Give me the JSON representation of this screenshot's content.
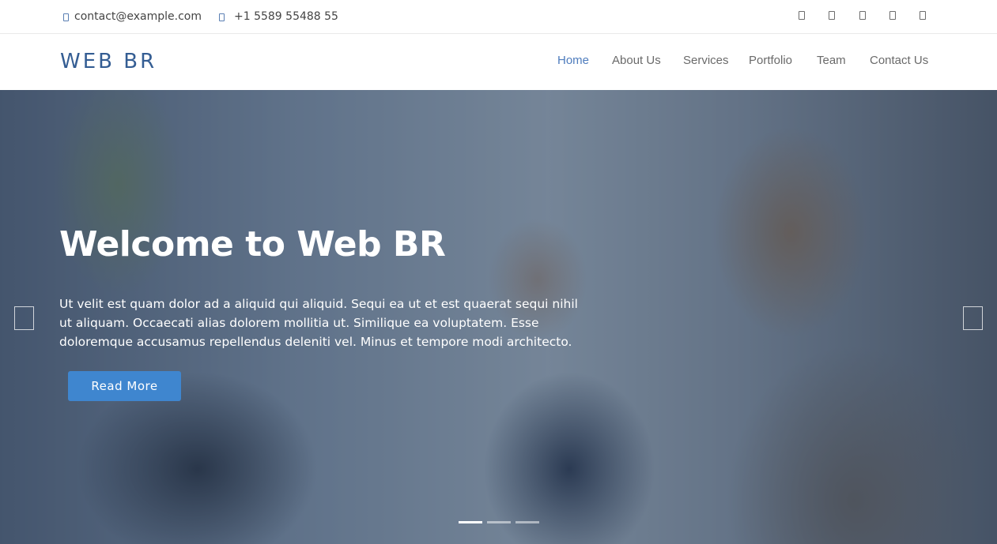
{
  "topbar": {
    "email": "contact@example.com",
    "phone": "+1 5589 55488 55",
    "social_icons": [
      "twitter-icon",
      "facebook-icon",
      "instagram-icon",
      "skype-icon",
      "linkedin-icon"
    ]
  },
  "header": {
    "logo": "WEB BR",
    "nav": [
      {
        "label": "Home",
        "active": true
      },
      {
        "label": "About Us",
        "active": false
      },
      {
        "label": "Services",
        "active": false
      },
      {
        "label": "Portfolio",
        "active": false
      },
      {
        "label": "Team",
        "active": false
      },
      {
        "label": "Contact Us",
        "active": false
      }
    ]
  },
  "hero": {
    "title": "Welcome to Web BR",
    "text": "Ut velit est quam dolor ad a aliquid qui aliquid. Sequi ea ut et est quaerat sequi nihil ut aliquam. Occaecati alias dolorem mollitia ut. Similique ea voluptatem. Esse doloremque accusamus repellendus deleniti vel. Minus et tempore modi architecto.",
    "button_label": "Read More",
    "slides_total": 3,
    "active_slide": 1
  },
  "colors": {
    "accent": "#3f86cf",
    "logo": "#345d93",
    "nav_active": "#4e7cbd"
  }
}
